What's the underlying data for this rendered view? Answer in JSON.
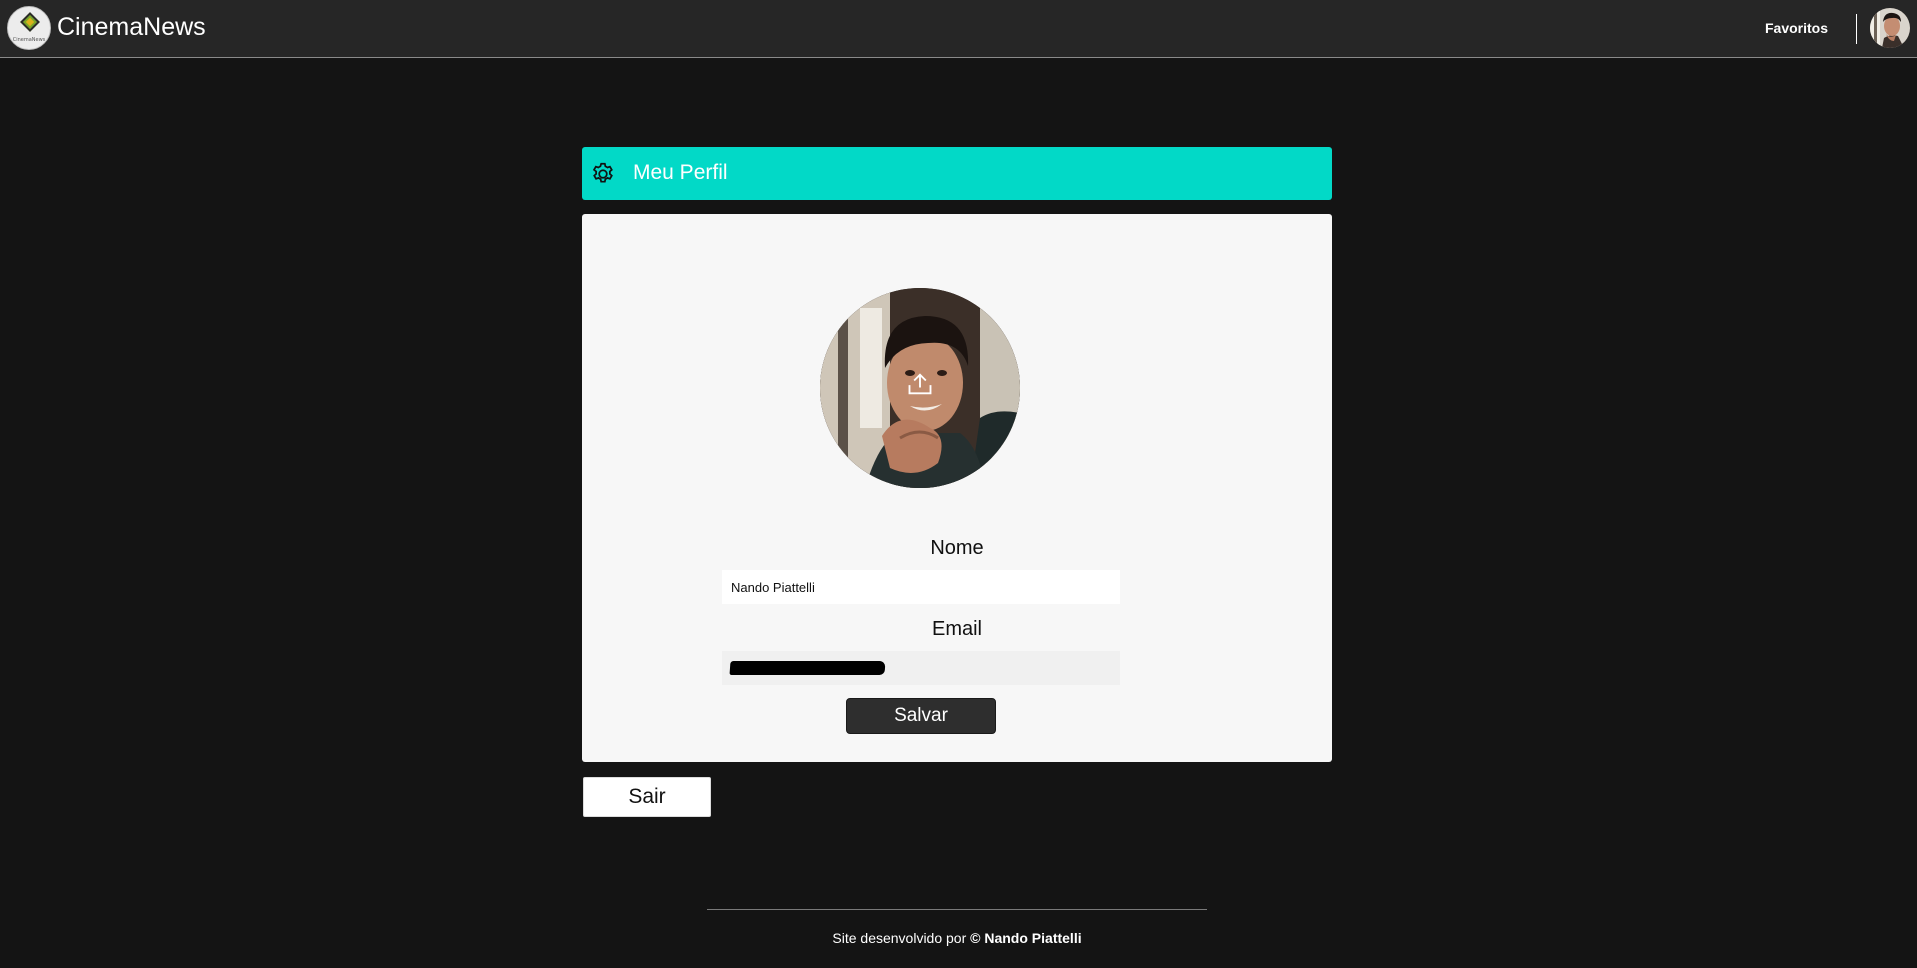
{
  "header": {
    "brand": "CinemaNews",
    "logo_text": "CinemaNews",
    "favorites_label": "Favoritos"
  },
  "profile": {
    "title": "Meu Perfil",
    "name_label": "Nome",
    "name_value": "Nando Piattelli",
    "email_label": "Email",
    "email_value": "",
    "save_label": "Salvar"
  },
  "logout_label": "Sair",
  "footer": {
    "prefix": "Site desenvolvido por",
    "author": "© Nando Piattelli"
  },
  "colors": {
    "accent": "#02d9c7",
    "background": "#141414",
    "topbar": "#262626",
    "card": "#f7f7f7"
  },
  "icons": {
    "settings": "gear-icon",
    "upload": "upload-icon"
  }
}
